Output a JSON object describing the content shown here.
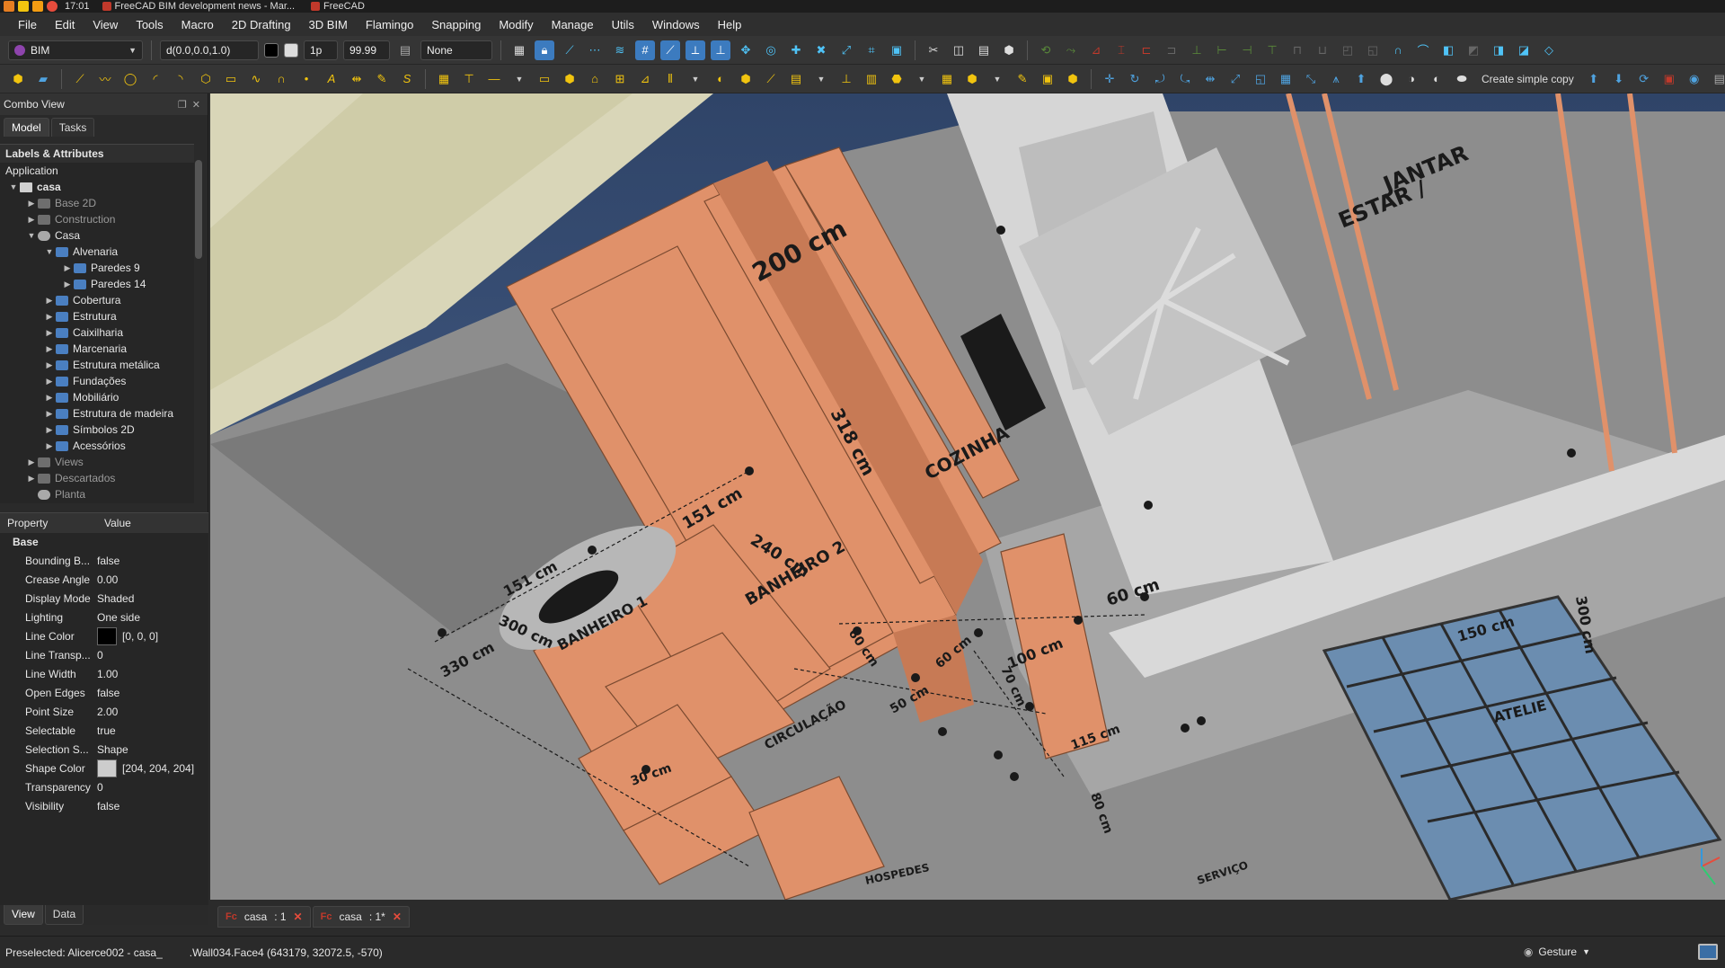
{
  "titlebar": {
    "clock": "17:01",
    "window_title": "FreeCAD BIM development news - Mar...",
    "app_title": "FreeCAD"
  },
  "menu": [
    "File",
    "Edit",
    "View",
    "Tools",
    "Macro",
    "2D Drafting",
    "3D BIM",
    "Flamingo",
    "Snapping",
    "Modify",
    "Manage",
    "Utils",
    "Windows",
    "Help"
  ],
  "toolbar": {
    "workbench": "BIM",
    "working_plane": "d(0.0,0.0,1.0)",
    "line_width": "1p",
    "zoom_value": "99.99",
    "snap_mode": "None",
    "create_simple_copy": "Create simple copy"
  },
  "combo_view": {
    "title": "Combo View",
    "tabs": [
      "Model",
      "Tasks"
    ],
    "labels_attributes": "Labels & Attributes",
    "application": "Application",
    "tree": [
      {
        "label": "casa",
        "level": 0,
        "expanded": true,
        "bold": true,
        "icon": "document-icon"
      },
      {
        "label": "Base 2D",
        "level": 1,
        "expanded": false,
        "dim": true,
        "icon": "folder-icon"
      },
      {
        "label": "Construction",
        "level": 1,
        "expanded": false,
        "dim": true,
        "icon": "folder-icon"
      },
      {
        "label": "Casa",
        "level": 1,
        "expanded": true,
        "icon": "building-icon"
      },
      {
        "label": "Alvenaria",
        "level": 2,
        "expanded": true,
        "icon": "folder-icon"
      },
      {
        "label": "Paredes 9",
        "level": 3,
        "expanded": false,
        "icon": "folder-icon"
      },
      {
        "label": "Paredes 14",
        "level": 3,
        "expanded": false,
        "icon": "folder-icon"
      },
      {
        "label": "Cobertura",
        "level": 2,
        "expanded": false,
        "icon": "folder-icon"
      },
      {
        "label": "Estrutura",
        "level": 2,
        "expanded": false,
        "icon": "folder-icon"
      },
      {
        "label": "Caixilharia",
        "level": 2,
        "expanded": false,
        "icon": "folder-icon"
      },
      {
        "label": "Marcenaria",
        "level": 2,
        "expanded": false,
        "icon": "folder-icon"
      },
      {
        "label": "Estrutura metálica",
        "level": 2,
        "expanded": false,
        "icon": "folder-icon"
      },
      {
        "label": "Fundações",
        "level": 2,
        "expanded": false,
        "icon": "folder-icon"
      },
      {
        "label": "Mobiliário",
        "level": 2,
        "expanded": false,
        "icon": "folder-icon"
      },
      {
        "label": "Estrutura de madeira",
        "level": 2,
        "expanded": false,
        "icon": "folder-icon"
      },
      {
        "label": "Símbolos 2D",
        "level": 2,
        "expanded": false,
        "icon": "folder-icon"
      },
      {
        "label": "Acessórios",
        "level": 2,
        "expanded": false,
        "icon": "folder-icon"
      },
      {
        "label": "Views",
        "level": 1,
        "expanded": false,
        "dim": true,
        "icon": "folder-icon"
      },
      {
        "label": "Descartados",
        "level": 1,
        "expanded": false,
        "dim": true,
        "icon": "folder-icon"
      },
      {
        "label": "Planta",
        "level": 1,
        "expanded": null,
        "dim": true,
        "icon": "building-icon"
      }
    ],
    "properties": {
      "headers": [
        "Property",
        "Value"
      ],
      "group": "Base",
      "rows": [
        {
          "name": "Bounding B...",
          "value": "false"
        },
        {
          "name": "Crease Angle",
          "value": "0.00"
        },
        {
          "name": "Display Mode",
          "value": "Shaded"
        },
        {
          "name": "Lighting",
          "value": "One side"
        },
        {
          "name": "Line Color",
          "value": "[0, 0, 0]",
          "swatch": "#000000"
        },
        {
          "name": "Line Transp...",
          "value": "0"
        },
        {
          "name": "Line Width",
          "value": "1.00"
        },
        {
          "name": "Open Edges",
          "value": "false"
        },
        {
          "name": "Point Size",
          "value": "2.00"
        },
        {
          "name": "Selectable",
          "value": "true"
        },
        {
          "name": "Selection S...",
          "value": "Shape"
        },
        {
          "name": "Shape Color",
          "value": "[204, 204, 204]",
          "swatch": "#cccccc"
        },
        {
          "name": "Transparency",
          "value": "0"
        },
        {
          "name": "Visibility",
          "value": "false"
        }
      ]
    },
    "bottom_tabs": [
      "View",
      "Data"
    ]
  },
  "viewport": {
    "dimension_labels": [
      "200 cm",
      "318 cm",
      "151 cm",
      "240 cm",
      "151 cm",
      "300 cm",
      "330 cm",
      "60 cm",
      "100 cm",
      "60 cm",
      "60 cm",
      "70 cm",
      "50 cm",
      "115 cm",
      "300 cm",
      "150 cm",
      "80 cm",
      "30 cm"
    ],
    "room_labels": [
      "COZINHA",
      "BANHEIRO 2",
      "BANHEIRO 1",
      "CIRCULAÇÃO",
      "ESTAR /",
      "JANTAR",
      "ATELIE",
      "HOSPEDES",
      "SERVIÇO"
    ]
  },
  "doc_tabs": [
    {
      "name": "casa",
      "suffix": ": 1"
    },
    {
      "name": "casa",
      "suffix": ": 1*"
    }
  ],
  "status": {
    "preselected": "Preselected: Alicerce002 - casa_",
    "coords": ".Wall034.Face4 (643179, 32072.5, -570)",
    "navigation": "Gesture"
  },
  "colors": {
    "wood": "#e0916a",
    "wall": "#c9c9c9",
    "sky": "#3b4e6d"
  }
}
